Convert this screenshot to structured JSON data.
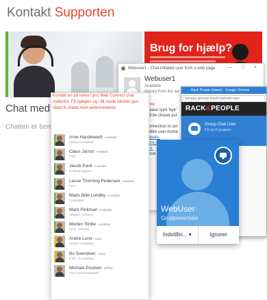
{
  "site": {
    "title_part1": "Kontakt",
    "title_part2": "Supporten",
    "promo_text": "Brug for hjælp?",
    "chat_heading": "Chat med S",
    "chat_sub": "Chatten er bem"
  },
  "contacts_panel": {
    "intro": "Kontakt en på vores Lync Web Connect chat nedenfor. Få hjælpen og i tilt mede teksten gen rådet til chatte med vedkommende",
    "items": [
      {
        "name": "Arne Handewedt",
        "status": "Available",
        "role": "Senior Consultant",
        "status_color": "#5cb531"
      },
      {
        "name": "Claus Jarnst",
        "status": "Available",
        "role": "CTO",
        "status_color": "#5cb531"
      },
      {
        "name": "Jacob Pauli",
        "status": "Available",
        "role": "Hosting Support",
        "status_color": "#5cb531"
      },
      {
        "name": "Lasse Thorning Pedersen",
        "status": "Available",
        "role": "CEO",
        "status_color": "#5cb531"
      },
      {
        "name": "Mads Bille Lundby",
        "status": "Available",
        "role": "Consultant",
        "status_color": "#5cb531"
      },
      {
        "name": "Mark Pinkman",
        "status": "Available",
        "role": "Solution Architect",
        "status_color": "#5cb531"
      },
      {
        "name": "Morten Stribe",
        "status": "Available",
        "role": "CFO - Hosting",
        "status_color": "#5cb531"
      },
      {
        "name": "Andre Lund",
        "status": "Away",
        "role": "Senior Consultant",
        "status_color": "#f2c200"
      },
      {
        "name": "Bo Svendsen",
        "status": "Away",
        "role": "CTO - Consulting",
        "status_color": "#f2c200"
      },
      {
        "name": "Michael Poulsen",
        "status": "Offline",
        "role": "Key Account Manager",
        "status_color": "#bdbdbd"
      }
    ]
  },
  "skype_window": {
    "title": "Webuser1 - Chat initiated user from a web page.",
    "window_controls": "— □ ×",
    "contact_name": "Webuser1",
    "contact_status": "Available",
    "contact_sub": "Inquiry from the we",
    "messages": [
      {
        "text": "rror",
        "style": "red"
      },
      {
        "text": "lease type 'bye'",
        "style": "normal"
      },
      {
        "text": "ill be closed aut",
        "style": "normal"
      },
      {
        "text": "onnection to ser",
        "style": "normal"
      },
      {
        "text": "Web user Andre",
        "style": "normal"
      },
      {
        "text": "andre.",
        "style": "link"
      },
      {
        "text": "ore sm",
        "style": "link"
      },
      {
        "text": "re.",
        "style": "link"
      },
      {
        "text": "hod",
        "style": "normal"
      }
    ]
  },
  "rack_window": {
    "titlebar": "Rack People (intern) - Google Chrome",
    "address": "lyncapp.jpeergn.local/chat/web.aspx",
    "logo_part1": "RACK",
    "logo_amp": "&",
    "logo_part2": "PEOPLE",
    "chat_name": "Group Chat User",
    "chat_sub": "På vej til gruppen"
  },
  "call_window": {
    "name": "WebUser",
    "subtitle": "Gruppesamtale",
    "settings_button": "Indstillin... ▾",
    "ignore_button": "Ignorer"
  },
  "colors": {
    "accent_red": "#e8472e",
    "lync_blue": "#2a7fd4",
    "available_green": "#5cb531",
    "away_yellow": "#f2c200"
  }
}
